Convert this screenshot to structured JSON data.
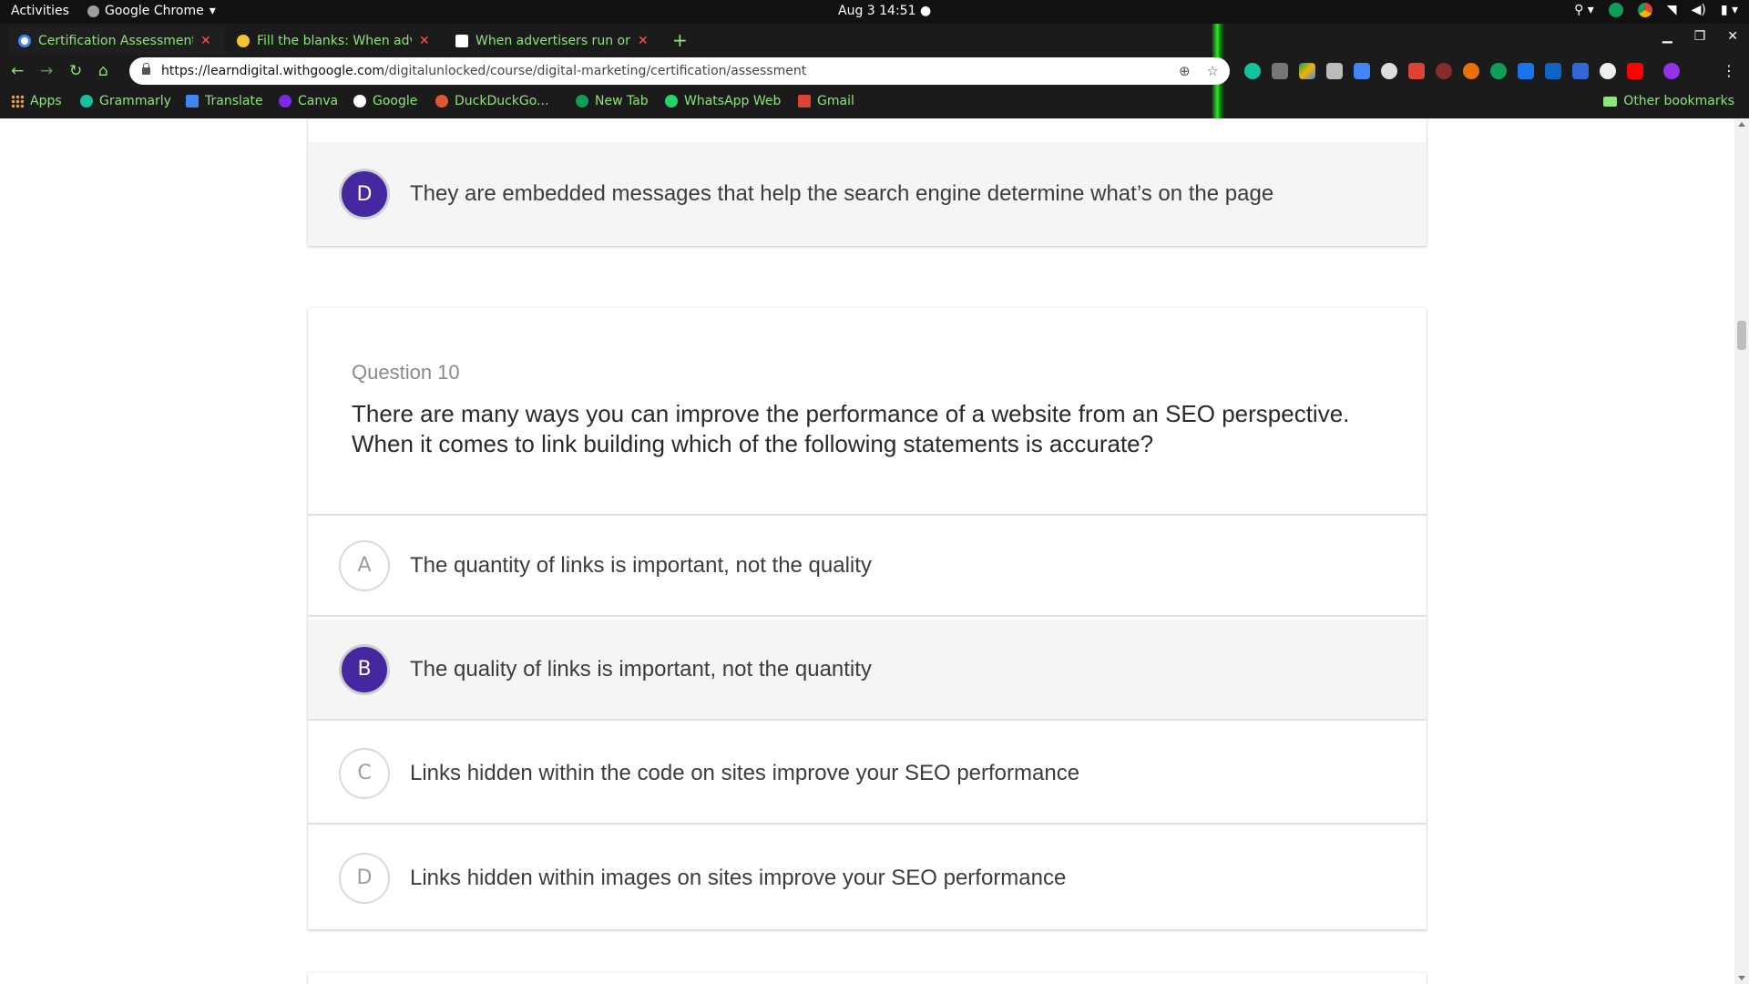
{
  "os": {
    "activities": "Activities",
    "app_name": "Google Chrome",
    "clock": "Aug 3  14:51"
  },
  "browser": {
    "tabs": [
      {
        "title": "Certification Assessment",
        "active": true
      },
      {
        "title": "Fill the blanks: When adv",
        "active": false
      },
      {
        "title": "When advertisers run onl",
        "active": false
      }
    ],
    "url_host": "https://learndigital.withgoogle.com",
    "url_path": "/digitalunlocked/course/digital-marketing/certification/assessment",
    "bookmarks": [
      {
        "label": "Apps"
      },
      {
        "label": "Grammarly"
      },
      {
        "label": "Translate"
      },
      {
        "label": "Canva"
      },
      {
        "label": "Google"
      },
      {
        "label": "DuckDuckGo..."
      },
      {
        "label": "New Tab"
      },
      {
        "label": "WhatsApp Web"
      },
      {
        "label": "Gmail"
      }
    ],
    "other_bookmarks": "Other bookmarks"
  },
  "previous_question": {
    "option_d": {
      "letter": "D",
      "text": "They are embedded messages that help the search engine determine what’s on the page",
      "selected": true
    }
  },
  "question": {
    "number_label": "Question 10",
    "text": "There are many ways you can improve the performance of a website from an SEO perspective. When it comes to link building which of the following statements is accurate?",
    "options": [
      {
        "letter": "A",
        "text": "The quantity of links is important, not the quality",
        "selected": false
      },
      {
        "letter": "B",
        "text": "The quality of links is important, not the quantity",
        "selected": true
      },
      {
        "letter": "C",
        "text": "Links hidden within the code on sites improve your SEO performance",
        "selected": false
      },
      {
        "letter": "D",
        "text": "Links hidden within images on sites improve your SEO performance",
        "selected": false
      }
    ]
  },
  "colors": {
    "selected_badge": "#4527a0",
    "chrome_accent": "#8fe37a"
  }
}
